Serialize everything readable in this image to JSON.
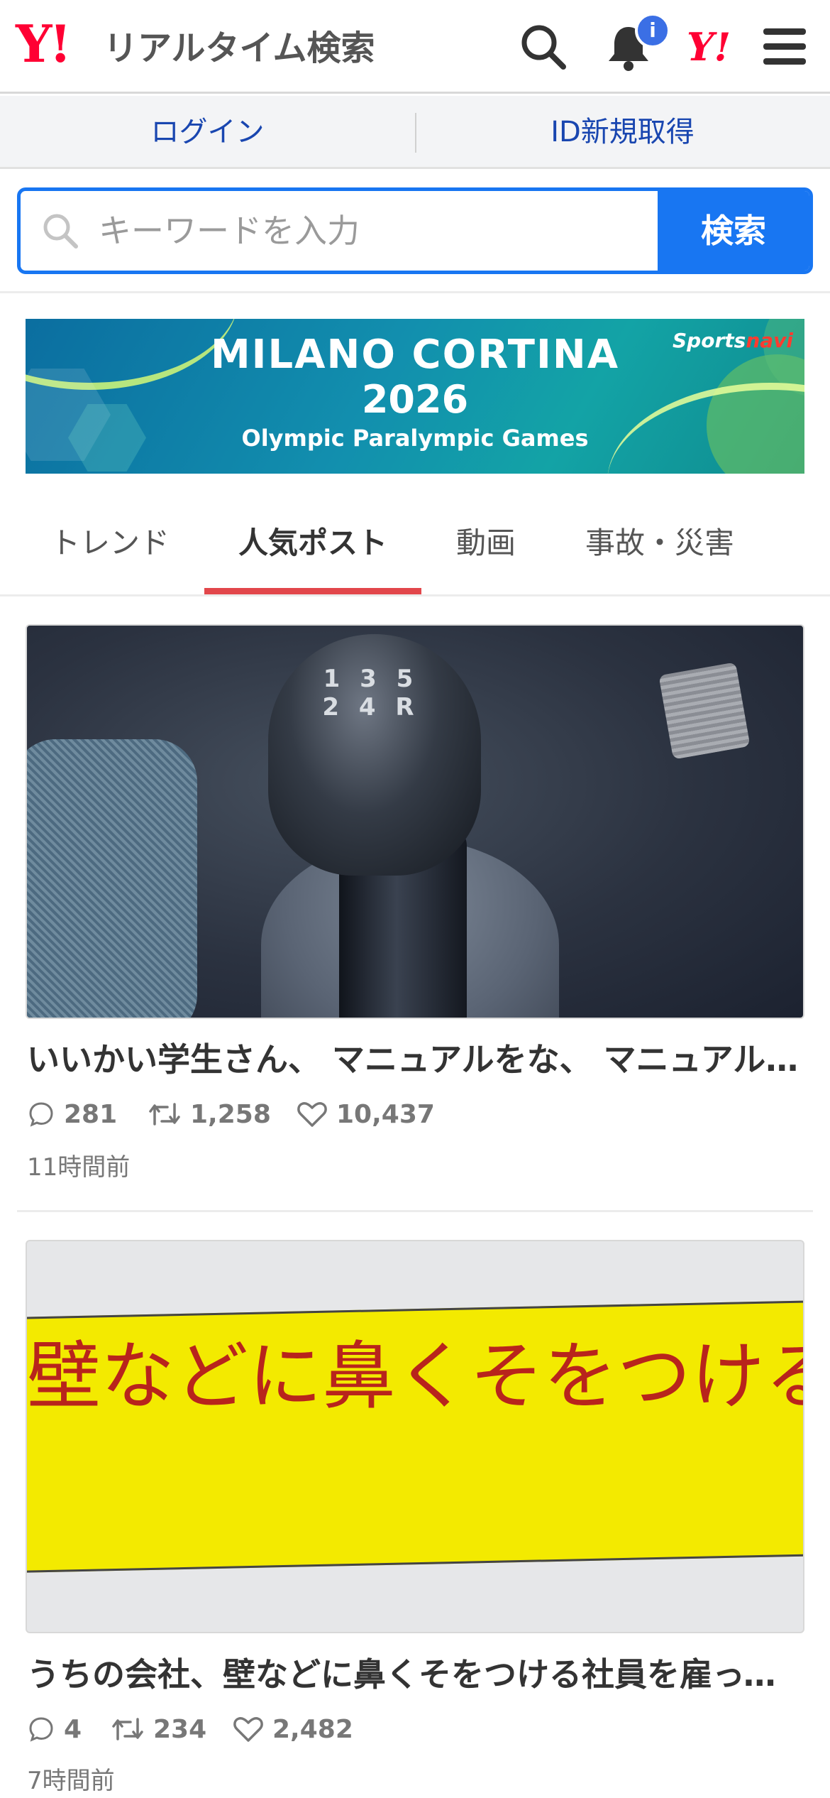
{
  "header": {
    "logo_mark": "Y!",
    "logo_text": "リアルタイム検索",
    "notification_badge": "i",
    "yahoo_mark": "Y!"
  },
  "account": {
    "login_label": "ログイン",
    "signup_label": "ID新規取得"
  },
  "search": {
    "placeholder": "キーワードを入力",
    "button_label": "検索"
  },
  "banner": {
    "title": "MILANO CORTINA",
    "year": "2026",
    "subtitle": "Olympic Paralympic Games",
    "brand_sports": "Sports",
    "brand_navi": "navi"
  },
  "tabs": [
    {
      "label": "トレンド",
      "active": false
    },
    {
      "label": "人気ポスト",
      "active": true
    },
    {
      "label": "動画",
      "active": false
    },
    {
      "label": "事故・災害",
      "active": false
    }
  ],
  "posts": [
    {
      "image_pattern": "1 3 5\n2 4 R",
      "title": "いいかい学生さん、 マニュアルをな、 マニュアルをな",
      "replies": "281",
      "reposts": "1,258",
      "likes": "10,437",
      "time": "11時間前"
    },
    {
      "image_text": "壁などに鼻くそをつけるな",
      "title": "うちの会社、壁などに鼻くそをつける社員を雇っている",
      "replies": "4",
      "reposts": "234",
      "likes": "2,482",
      "time": "7時間前"
    }
  ],
  "colors": {
    "brand_red": "#ff0033",
    "accent_blue": "#1876f2",
    "link_blue": "#1946b0",
    "tab_underline": "#e2474b"
  }
}
